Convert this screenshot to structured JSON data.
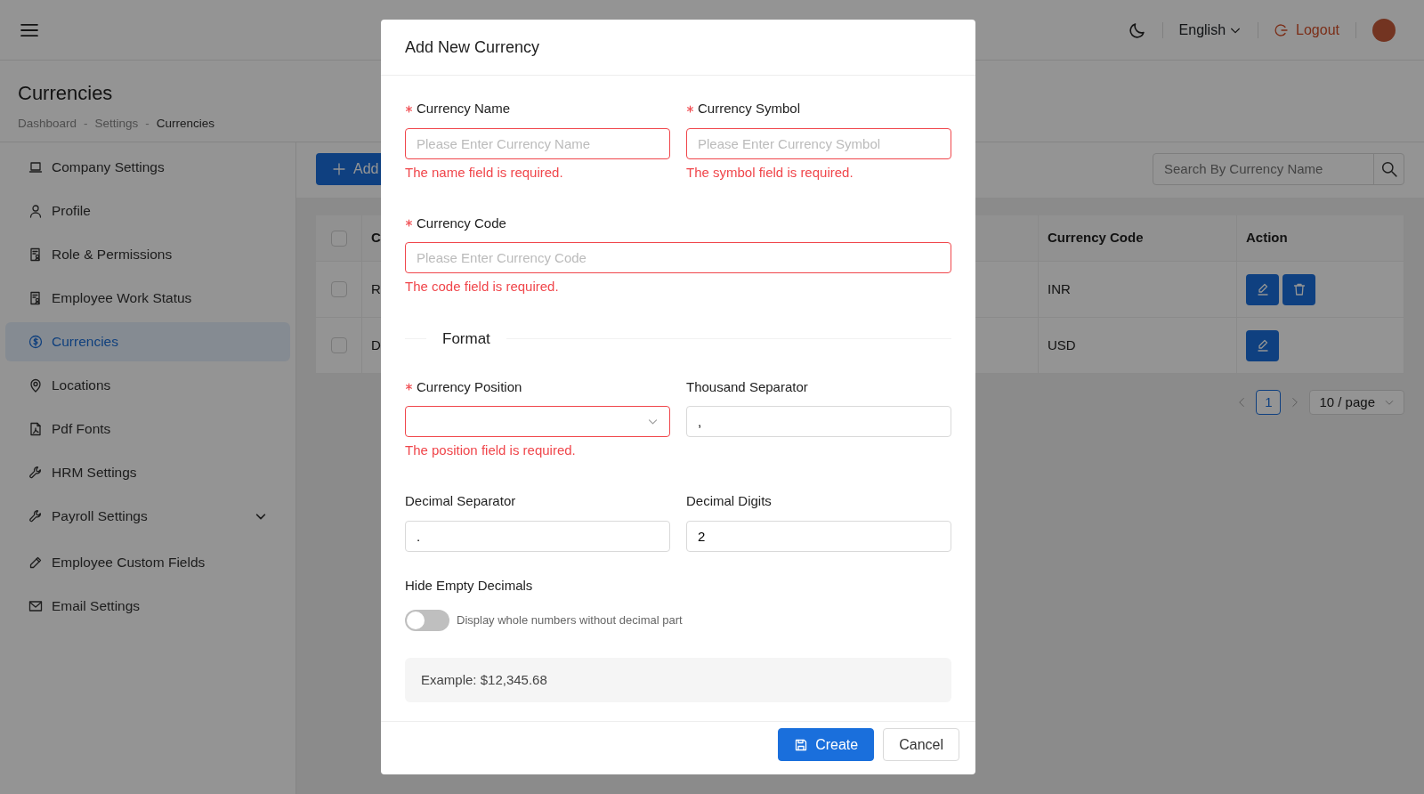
{
  "header": {
    "language": "English",
    "logout": "Logout"
  },
  "page": {
    "title": "Currencies",
    "breadcrumb": [
      {
        "kind": "link",
        "text": "Dashboard"
      },
      {
        "kind": "separator",
        "text": "-"
      },
      {
        "kind": "link",
        "text": "Settings"
      },
      {
        "kind": "separator",
        "text": "-"
      },
      {
        "kind": "current",
        "text": "Currencies"
      }
    ]
  },
  "sidebar": {
    "items": [
      {
        "label": "Company Settings",
        "selected": false
      },
      {
        "label": "Profile",
        "selected": false
      },
      {
        "label": "Role & Permissions",
        "selected": false
      },
      {
        "label": "Employee Work Status",
        "selected": false
      },
      {
        "label": "Currencies",
        "selected": true
      },
      {
        "label": "Locations",
        "selected": false
      },
      {
        "label": "Pdf Fonts",
        "selected": false
      },
      {
        "label": "HRM Settings",
        "selected": false
      },
      {
        "label": "Payroll Settings",
        "selected": false,
        "expanded": false
      },
      {
        "label": "Employee Custom Fields",
        "selected": false
      },
      {
        "label": "Email Settings",
        "selected": false
      }
    ]
  },
  "toolbar": {
    "add_button": "Add",
    "search": {
      "placeholder": "Search By Currency Name"
    }
  },
  "table": {
    "header_checked": false,
    "columns": [
      "C",
      "Currency Code",
      "Action"
    ],
    "rows": [
      {
        "checked": false,
        "cells": [
          "R",
          "INR"
        ],
        "actions": [
          {
            "kind": "edit"
          },
          {
            "kind": "delete"
          }
        ]
      },
      {
        "checked": false,
        "cells": [
          "D",
          "USD"
        ],
        "actions": [
          {
            "kind": "edit"
          }
        ]
      }
    ]
  },
  "pagination": {
    "pages": [
      {
        "label": "1",
        "selected": true
      }
    ],
    "page_size": "10 / page"
  },
  "modal": {
    "title": "Add New Currency",
    "rows": [
      {
        "kind": "fields",
        "fields": [
          {
            "kind": "input",
            "label": "Currency Name",
            "required": true,
            "placeholder": "Please Enter Currency Name",
            "error": "The name field is required."
          },
          {
            "kind": "input",
            "label": "Currency Symbol",
            "required": true,
            "placeholder": "Please Enter Currency Symbol",
            "error": "The symbol field is required."
          }
        ]
      },
      {
        "kind": "fields",
        "fields": [
          {
            "kind": "input",
            "label": "Currency Code",
            "required": true,
            "placeholder": "Please Enter Currency Code",
            "error": "The code field is required."
          }
        ]
      },
      {
        "kind": "section",
        "title": "Format"
      },
      {
        "kind": "fields",
        "fields": [
          {
            "kind": "select",
            "label": "Currency Position",
            "required": true,
            "error": "The position field is required."
          },
          {
            "kind": "input",
            "label": "Thousand Separator",
            "required": false,
            "value": ","
          }
        ]
      },
      {
        "kind": "fields",
        "fields": [
          {
            "kind": "input",
            "label": "Decimal Separator",
            "required": false,
            "value": "."
          },
          {
            "kind": "input",
            "label": "Decimal Digits",
            "required": false,
            "value": "2"
          }
        ]
      }
    ],
    "toggle": {
      "label": "Hide Empty Decimals",
      "on": false,
      "description": "Display whole numbers without decimal part"
    },
    "example": "Example: $12,345.68",
    "buttons": [
      {
        "kind": "primary",
        "label": "Create"
      },
      {
        "kind": "default",
        "label": "Cancel"
      }
    ]
  }
}
